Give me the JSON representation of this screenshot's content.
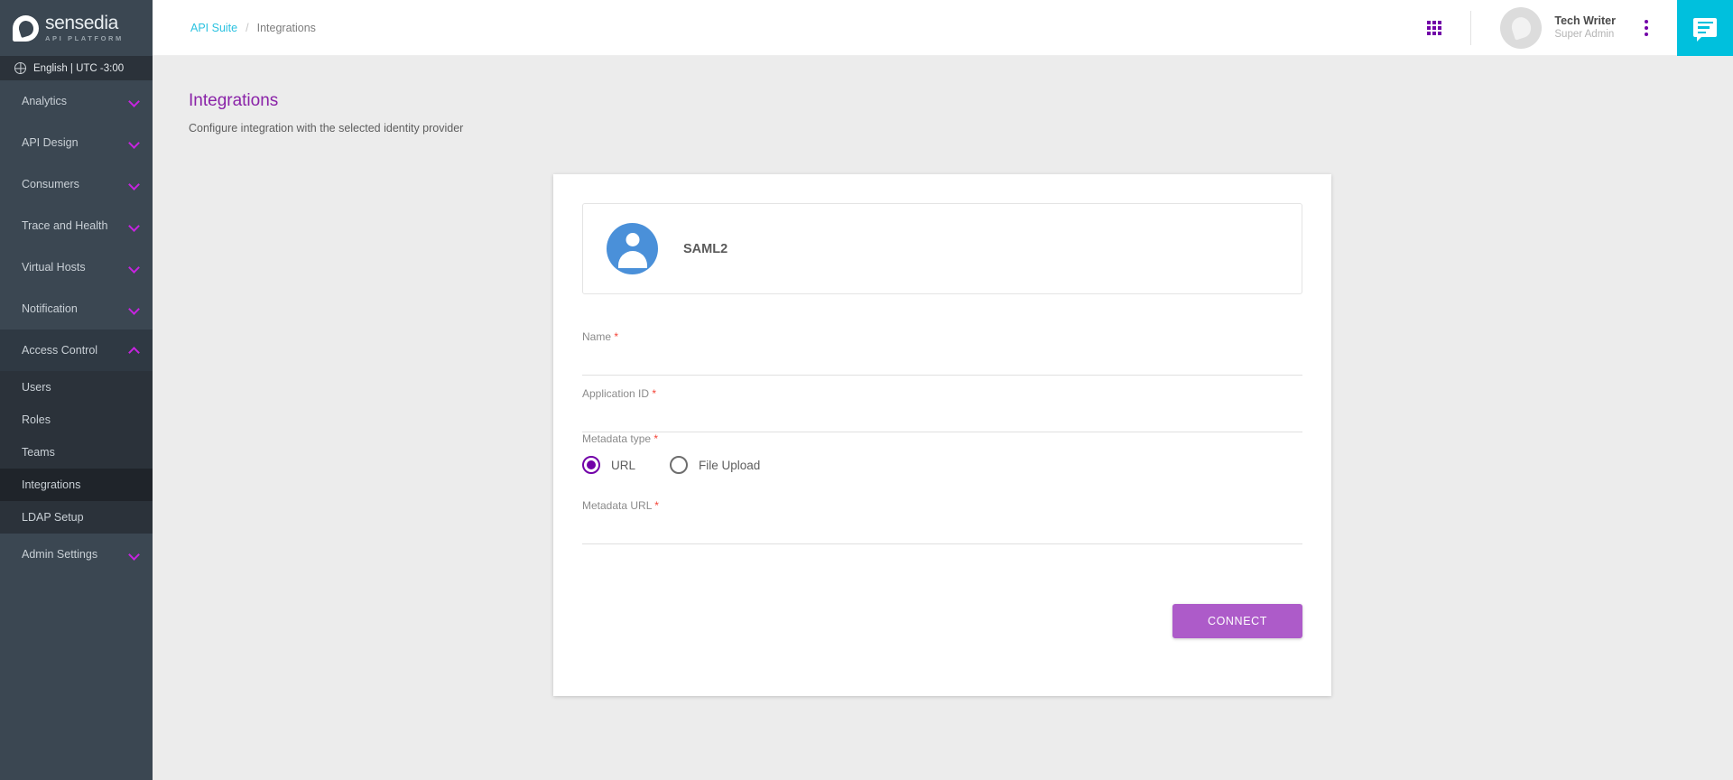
{
  "brand": {
    "logo_name": "sensedia",
    "logo_sub": "API PLATFORM",
    "accent_purple": "#7200a8",
    "accent_magenta": "#c724e0",
    "accent_cyan": "#00c0dd",
    "sidebar_bg": "#3b4752"
  },
  "sidebar": {
    "language_bar": {
      "icon": "globe-icon",
      "label": "English | UTC -3:00"
    },
    "items": [
      {
        "label": "Analytics",
        "type": "group",
        "expanded": false,
        "icon": "chevron-down-icon"
      },
      {
        "label": "API Design",
        "type": "group",
        "expanded": false,
        "icon": "chevron-down-icon"
      },
      {
        "label": "Consumers",
        "type": "group",
        "expanded": false,
        "icon": "chevron-down-icon"
      },
      {
        "label": "Trace and Health",
        "type": "group",
        "expanded": false,
        "icon": "chevron-down-icon"
      },
      {
        "label": "Virtual Hosts",
        "type": "group",
        "expanded": false,
        "icon": "chevron-down-icon"
      },
      {
        "label": "Notification",
        "type": "group",
        "expanded": false,
        "icon": "chevron-down-icon"
      },
      {
        "label": "Access Control",
        "type": "group",
        "expanded": true,
        "icon": "chevron-up-icon"
      },
      {
        "label": "Users",
        "type": "child",
        "active": false
      },
      {
        "label": "Roles",
        "type": "child",
        "active": false
      },
      {
        "label": "Teams",
        "type": "child",
        "active": false
      },
      {
        "label": "Integrations",
        "type": "child",
        "active": true
      },
      {
        "label": "LDAP Setup",
        "type": "child",
        "active": false
      },
      {
        "label": "Admin Settings",
        "type": "group",
        "expanded": false,
        "icon": "chevron-down-icon"
      }
    ]
  },
  "topbar": {
    "breadcrumb": {
      "root": "API Suite",
      "separator": "/",
      "current": "Integrations"
    },
    "apps_icon": "apps-grid-icon",
    "user": {
      "name": "Tech Writer",
      "role": "Super Admin",
      "avatar": "user-avatar"
    },
    "kebab_icon": "more-vertical-icon",
    "chat_icon": "chat-bubble-icon"
  },
  "page": {
    "title": "Integrations",
    "subtitle": "Configure integration with the selected identity provider"
  },
  "card": {
    "provider": {
      "icon": "account-circle-icon",
      "name": "SAML2"
    },
    "fields": [
      {
        "key": "name",
        "label": "Name",
        "required_mark": "*",
        "value": "",
        "placeholder": ""
      },
      {
        "key": "application_id",
        "label": "Application ID",
        "required_mark": "*",
        "value": "",
        "placeholder": ""
      },
      {
        "key": "metadata_url",
        "label": "Metadata URL",
        "required_mark": "*",
        "value": "",
        "placeholder": ""
      }
    ],
    "metadata_type": {
      "label": "Metadata type",
      "required_mark": "*",
      "options": [
        {
          "label": "URL",
          "selected": true
        },
        {
          "label": "File Upload",
          "selected": false
        }
      ]
    },
    "connect_label": "CONNECT"
  }
}
